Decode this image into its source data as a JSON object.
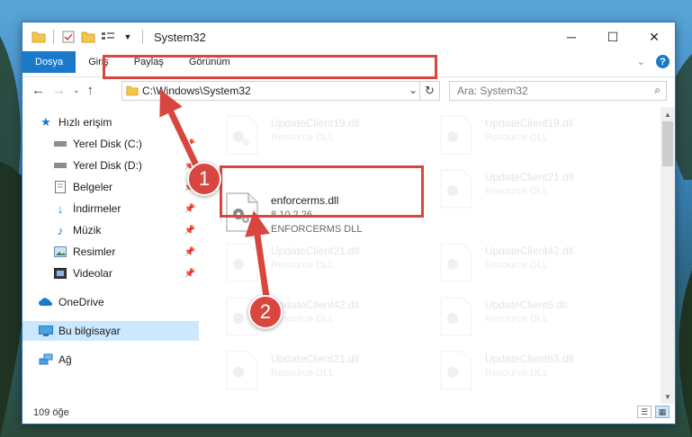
{
  "window": {
    "title": "System32",
    "controls": {
      "minimize": "─",
      "maximize": "☐",
      "close": "✕"
    }
  },
  "ribbon": {
    "tabs": [
      {
        "label": "Dosya",
        "active": true
      },
      {
        "label": "Giriş",
        "active": false
      },
      {
        "label": "Paylaş",
        "active": false
      },
      {
        "label": "Görünüm",
        "active": false
      }
    ],
    "help": "?"
  },
  "address": {
    "path": "C:\\Windows\\System32",
    "search_placeholder": "Ara: System32"
  },
  "sidebar": {
    "items": [
      {
        "label": "Hızlı erişim",
        "icon": "star-icon",
        "pinned": false
      },
      {
        "label": "Yerel Disk (C:)",
        "icon": "drive-icon",
        "pinned": true
      },
      {
        "label": "Yerel Disk (D:)",
        "icon": "drive-icon",
        "pinned": true
      },
      {
        "label": "Belgeler",
        "icon": "documents-icon",
        "pinned": true
      },
      {
        "label": "İndirmeler",
        "icon": "downloads-icon",
        "pinned": true
      },
      {
        "label": "Müzik",
        "icon": "music-icon",
        "pinned": true
      },
      {
        "label": "Resimler",
        "icon": "pictures-icon",
        "pinned": true
      },
      {
        "label": "Videolar",
        "icon": "videos-icon",
        "pinned": true
      },
      {
        "label": "OneDrive",
        "icon": "cloud-icon",
        "pinned": false
      },
      {
        "label": "Bu bilgisayar",
        "icon": "computer-icon",
        "pinned": false,
        "selected": true
      },
      {
        "label": "Ağ",
        "icon": "network-icon",
        "pinned": false
      }
    ]
  },
  "files": {
    "left_column": [
      {
        "name": "UpdateClient19.dll",
        "desc": "Resource DLL",
        "faded": true
      },
      {
        "name": "enforcerms.dll",
        "version": "8.10.2.26",
        "desc": "ENFORCERMS DLL",
        "faded": false
      },
      {
        "name": "UpdateClient21.dll",
        "desc": "Resource DLL",
        "faded": true
      },
      {
        "name": "UpdateClient42.dll",
        "desc": "Resource DLL",
        "faded": true
      },
      {
        "name": "UpdateClient21.dll",
        "desc": "Resource DLL",
        "faded": true
      }
    ],
    "right_column": [
      {
        "name": "UpdateClient19.dll",
        "desc": "Resource DLL",
        "faded": true
      },
      {
        "name": "UpdateClient21.dll",
        "desc": "Resource DLL",
        "faded": true
      },
      {
        "name": "UpdateClient42.dll",
        "desc": "Resource DLL",
        "faded": true
      },
      {
        "name": "UpdateClient5.dll",
        "desc": "Resource DLL",
        "faded": true
      },
      {
        "name": "UpdateClient63.dll",
        "desc": "Resource DLL",
        "faded": true
      }
    ]
  },
  "status": {
    "count": "109 öğe"
  },
  "annotations": {
    "step1": "1",
    "step2": "2",
    "color": "#d9463f"
  }
}
